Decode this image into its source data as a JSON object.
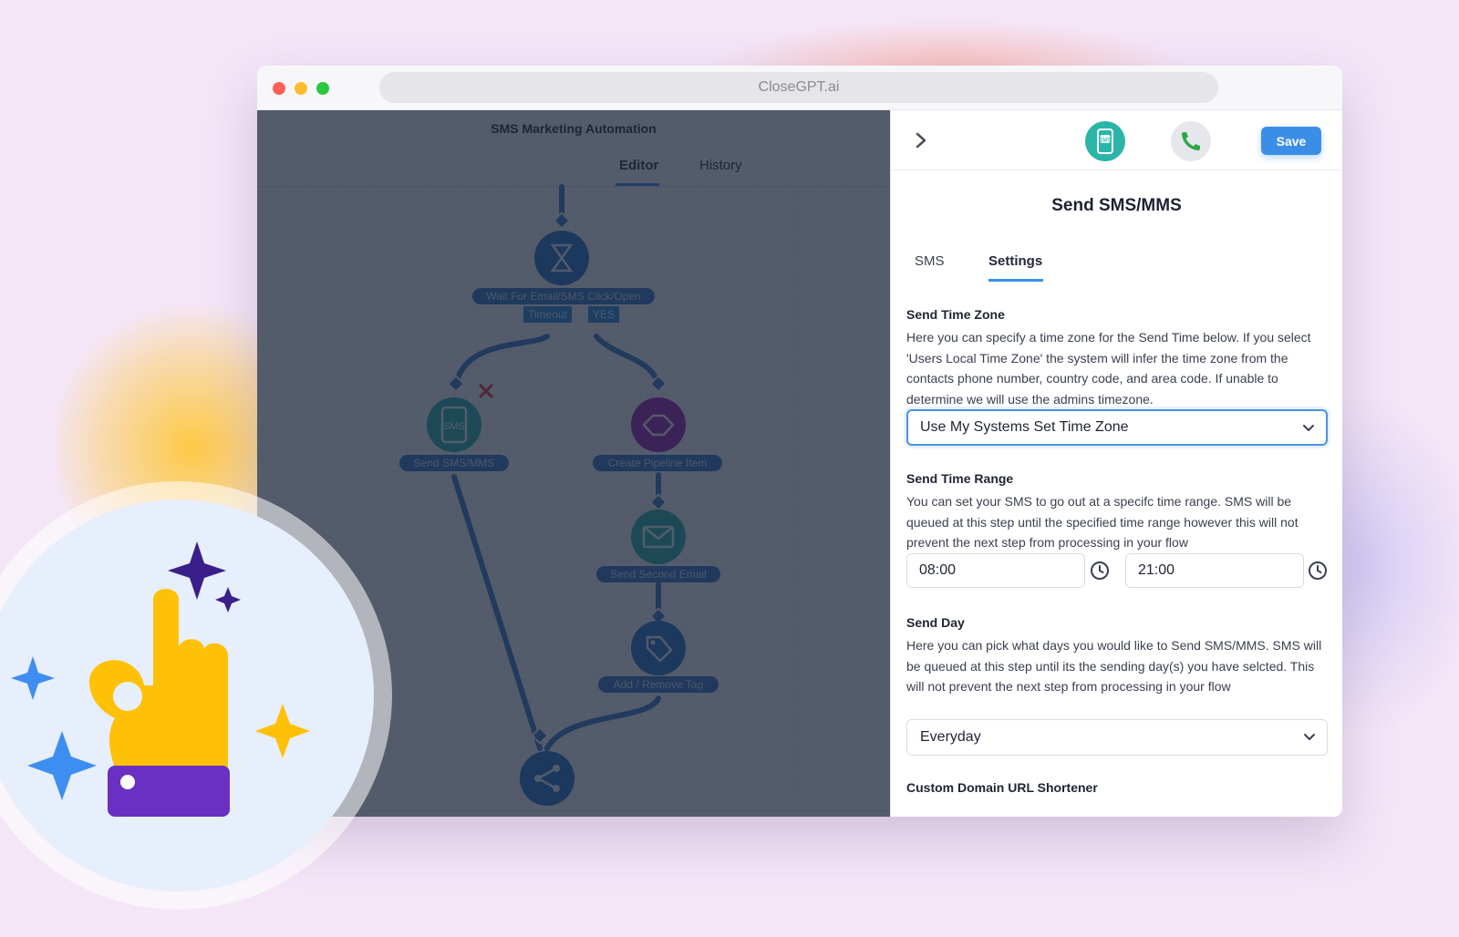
{
  "browser": {
    "url": "CloseGPT.ai"
  },
  "editor": {
    "title": "SMS Marketing Automation",
    "tabs": [
      {
        "label": "Editor",
        "active": true
      },
      {
        "label": "History",
        "active": false
      }
    ],
    "nodes": {
      "wait": "Wait For Email/SMS Click/Open",
      "timeout": "Timeout",
      "yes": "YES",
      "send_sms": "Send SMS/MMS",
      "sms_icon_text": "SMS",
      "pipeline": "Create Pipeline Item",
      "second_email": "Send Second Email",
      "tag": "Add / Remove Tag"
    }
  },
  "panel": {
    "save_label": "Save",
    "sms_icon_text": "SMS",
    "title": "Send SMS/MMS",
    "tabs": [
      {
        "label": "SMS",
        "active": false
      },
      {
        "label": "Settings",
        "active": true
      }
    ],
    "time_zone": {
      "heading": "Send Time Zone",
      "description": "Here you can specify a time zone for the Send Time below. If you select 'Users Local Time Zone' the system will infer the time zone from the contacts phone number, country code, and area code. If unable to determine we will use the admins timezone.",
      "selected": "Use My Systems Set Time Zone"
    },
    "time_range": {
      "heading": "Send Time Range",
      "description": "You can set your SMS to go out at a specifc time range. SMS will be queued at this step until the specified time range however this will not prevent the next step from processing in your flow",
      "start": "08:00",
      "end": "21:00"
    },
    "send_day": {
      "heading": "Send Day",
      "description": "Here you can pick what days you would like to Send SMS/MMS. SMS will be queued at this step until its the sending day(s) you have selcted. This will not prevent the next step from processing in your flow",
      "selected": "Everyday"
    },
    "url_shortener": {
      "heading": "Custom Domain URL Shortener"
    }
  },
  "colors": {
    "accent": "#3b8ee8",
    "sms_teal": "#2bb5a8",
    "phone_green": "#2aa84a",
    "badge_yellow": "#ffc107",
    "badge_purple": "#6a30c2",
    "sparkle_blue": "#3d8ef0",
    "sparkle_navy": "#3a1f8a"
  }
}
